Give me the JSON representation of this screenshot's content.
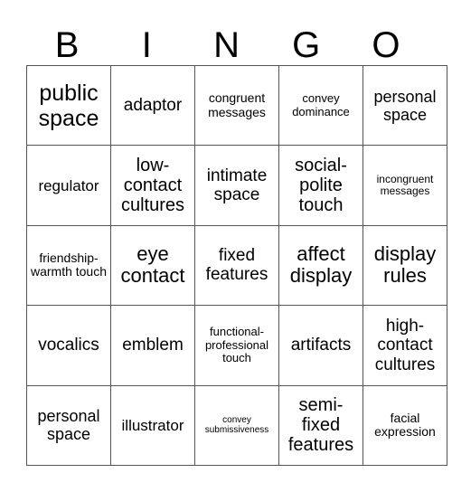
{
  "header": [
    "B",
    "I",
    "N",
    "G",
    "O"
  ],
  "rows": [
    [
      "public space",
      "adaptor",
      "congruent messages",
      "convey dominance",
      "personal space"
    ],
    [
      "regulator",
      "low-contact cultures",
      "intimate space",
      "social-polite touch",
      "incongruent messages"
    ],
    [
      "friendship-warmth touch",
      "eye contact",
      "fixed features",
      "affect display",
      "display rules"
    ],
    [
      "vocalics",
      "emblem",
      "functional-professional touch",
      "artifacts",
      "high-contact cultures"
    ],
    [
      "personal space",
      "illustrator",
      "convey submissiveness",
      "semi-fixed features",
      "facial expression"
    ]
  ]
}
